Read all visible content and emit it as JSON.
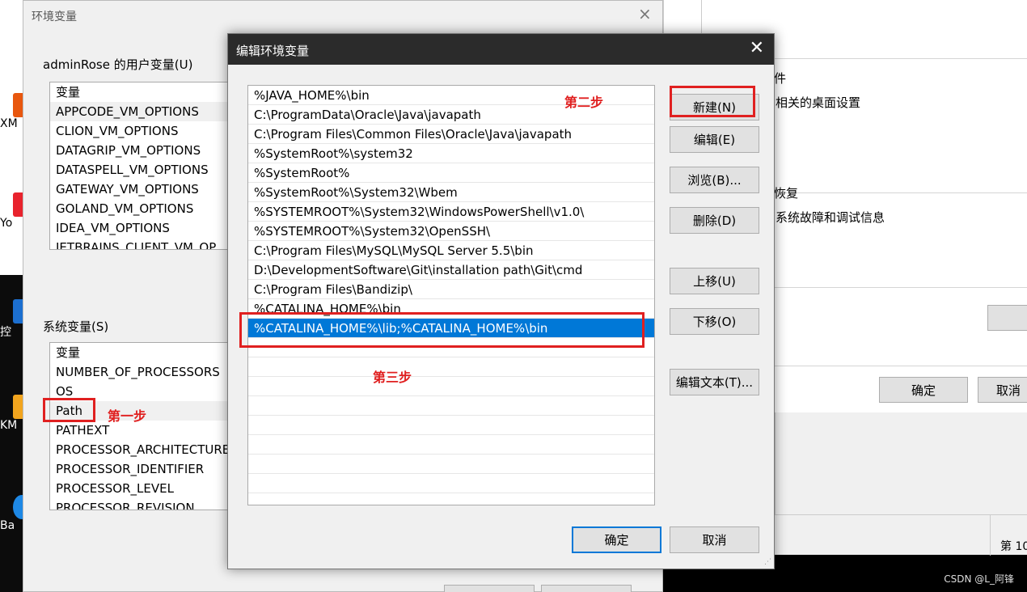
{
  "desktop": {
    "icons": [
      {
        "label": "XM",
        "color": "#e8570e"
      },
      {
        "label": "Yo",
        "color": "#e8232d"
      },
      {
        "label": "控",
        "color": "#1c6fd0"
      },
      {
        "label": "KM",
        "color": "#f2a51e"
      },
      {
        "label": "Ba",
        "color": "#1e88e5"
      }
    ]
  },
  "bg_window": {
    "texts": [
      "件",
      "相关的桌面设置",
      "恢复",
      "系统故障和调试信息"
    ],
    "ok_label": "确定",
    "cancel_label": "取消",
    "status_text": "第 10"
  },
  "watermark": "CSDN @L_阿锋",
  "env_window": {
    "title": "环境变量",
    "close_glyph": "×",
    "user_group_label": "adminRose 的用户变量(U)",
    "user_vars": {
      "header": "变量",
      "items": [
        "APPCODE_VM_OPTIONS",
        "CLION_VM_OPTIONS",
        "DATAGRIP_VM_OPTIONS",
        "DATASPELL_VM_OPTIONS",
        "GATEWAY_VM_OPTIONS",
        "GOLAND_VM_OPTIONS",
        "IDEA_VM_OPTIONS",
        "JETBRAINS_CLIENT_VM_OP"
      ]
    },
    "system_group_label": "系统变量(S)",
    "system_vars": {
      "header": "变量",
      "items": [
        "NUMBER_OF_PROCESSORS",
        "OS",
        "Path",
        "PATHEXT",
        "PROCESSOR_ARCHITECTURE",
        "PROCESSOR_IDENTIFIER",
        "PROCESSOR_LEVEL",
        "PROCESSOR_REVISION"
      ]
    }
  },
  "edit_dialog": {
    "title": "编辑环境变量",
    "close_glyph": "✕",
    "paths": [
      "%JAVA_HOME%\\bin",
      "C:\\ProgramData\\Oracle\\Java\\javapath",
      "C:\\Program Files\\Common Files\\Oracle\\Java\\javapath",
      "%SystemRoot%\\system32",
      "%SystemRoot%",
      "%SystemRoot%\\System32\\Wbem",
      "%SYSTEMROOT%\\System32\\WindowsPowerShell\\v1.0\\",
      "%SYSTEMROOT%\\System32\\OpenSSH\\",
      "C:\\Program Files\\MySQL\\MySQL Server 5.5\\bin",
      "D:\\DevelopmentSoftware\\Git\\installation path\\Git\\cmd",
      "C:\\Program Files\\Bandizip\\",
      "%CATALINA_HOME%\\bin",
      "%CATALINA_HOME%\\lib;%CATALINA_HOME%\\bin"
    ],
    "selected_index": 12,
    "buttons": {
      "new": "新建(N)",
      "edit": "编辑(E)",
      "browse": "浏览(B)...",
      "delete": "删除(D)",
      "move_up": "上移(U)",
      "move_down": "下移(O)",
      "edit_text": "编辑文本(T)...",
      "ok": "确定",
      "cancel": "取消"
    }
  },
  "annotations": {
    "step1": "第一步",
    "step2": "第二步",
    "step3": "第三步",
    "color": "#e02020"
  }
}
